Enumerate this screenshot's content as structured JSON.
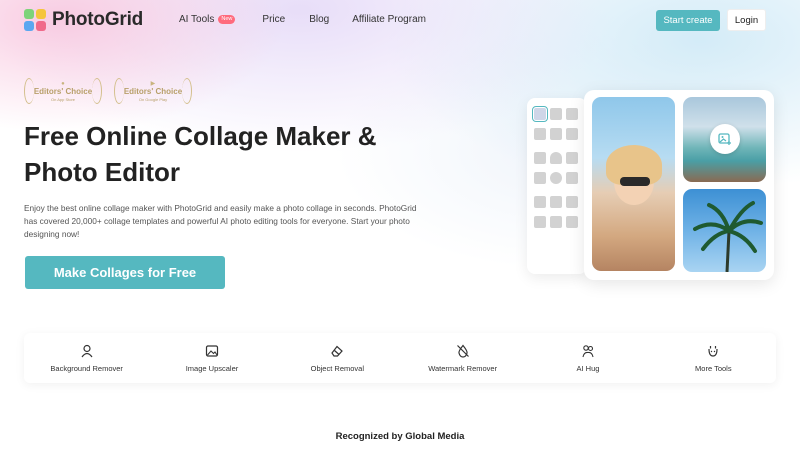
{
  "header": {
    "logo_text": "PhotoGrid",
    "nav": [
      {
        "label": "AI Tools",
        "badge": "New"
      },
      {
        "label": "Price"
      },
      {
        "label": "Blog"
      },
      {
        "label": "Affiliate Program"
      }
    ],
    "start_label": "Start create",
    "login_label": "Login"
  },
  "awards": [
    {
      "title": "Editors' Choice",
      "sub": "On App Store",
      "icon": "apple-icon"
    },
    {
      "title": "Editors' Choice",
      "sub": "On Google Play",
      "icon": "google-play-icon"
    }
  ],
  "hero": {
    "title": "Free Online Collage Maker & Photo Editor",
    "description": "Enjoy the best online collage maker with PhotoGrid and easily make a photo collage in seconds. PhotoGrid has covered 20,000+ collage templates and powerful AI photo editing tools for everyone. Start your photo designing now!",
    "cta_label": "Make Collages for Free"
  },
  "tools": [
    {
      "label": "Background Remover",
      "icon": "person-outline-icon"
    },
    {
      "label": "Image Upscaler",
      "icon": "image-icon"
    },
    {
      "label": "Object Removal",
      "icon": "eraser-icon"
    },
    {
      "label": "Watermark Remover",
      "icon": "drop-slash-icon"
    },
    {
      "label": "AI Hug",
      "icon": "hug-icon"
    },
    {
      "label": "More Tools",
      "icon": "more-tools-icon"
    }
  ],
  "recognized": "Recognized by Global Media",
  "colors": {
    "accent": "#55b8c0",
    "badge": "#ff6b7d",
    "award": "#b8a06a"
  }
}
